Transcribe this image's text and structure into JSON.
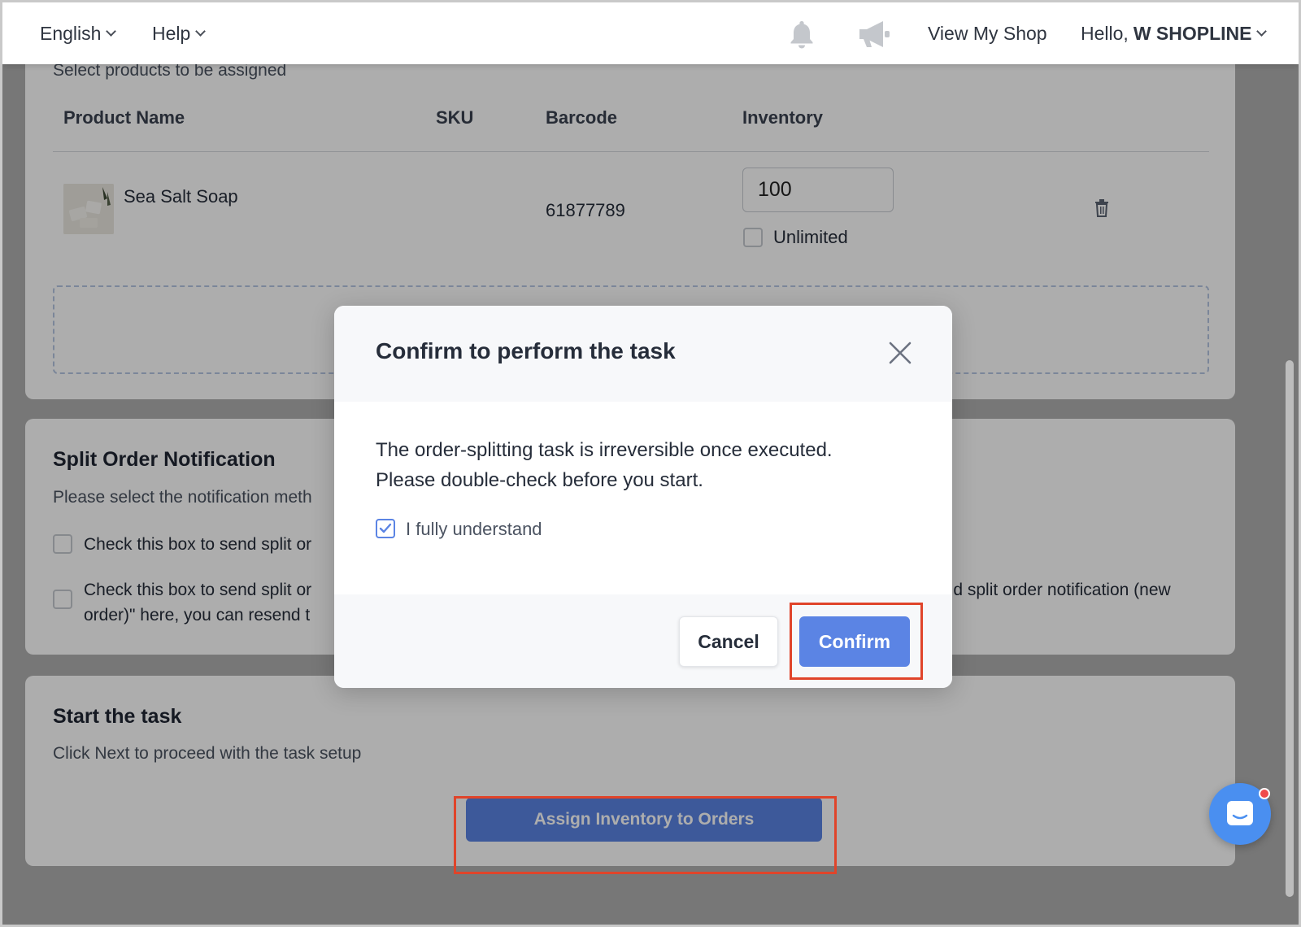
{
  "topbar": {
    "language": "English",
    "help": "Help",
    "view_shop": "View My Shop",
    "greeting": "Hello,",
    "user": "W SHOPLINE"
  },
  "assign_section": {
    "subtitle": "Select products to be assigned",
    "columns": [
      "Product Name",
      "SKU",
      "Barcode",
      "Inventory"
    ],
    "rows": [
      {
        "name": "Sea Salt Soap",
        "sku": "",
        "barcode": "61877789",
        "inventory": "100",
        "unlimited_label": "Unlimited",
        "unlimited_checked": false
      }
    ]
  },
  "notification_section": {
    "title": "Split Order Notification",
    "subtitle": "Please select the notification meth",
    "option1": "Check this box to send split or",
    "option2_line1_left": "Check this box to send split or",
    "option2_line1_right": "end split order notification (new",
    "option2_line2": "order)\" here, you can resend t"
  },
  "start_section": {
    "title": "Start the task",
    "subtitle": "Click Next to proceed with the task setup",
    "button": "Assign Inventory to Orders"
  },
  "modal": {
    "title": "Confirm to perform the task",
    "line1": "The order-splitting task is irreversible once executed.",
    "line2": "Please double-check before you start.",
    "checkbox_label": "I fully understand",
    "checkbox_checked": true,
    "cancel": "Cancel",
    "confirm": "Confirm"
  },
  "colors": {
    "primary": "#5b84e4",
    "highlight": "#e0442a",
    "chat": "#4a8ff0"
  }
}
